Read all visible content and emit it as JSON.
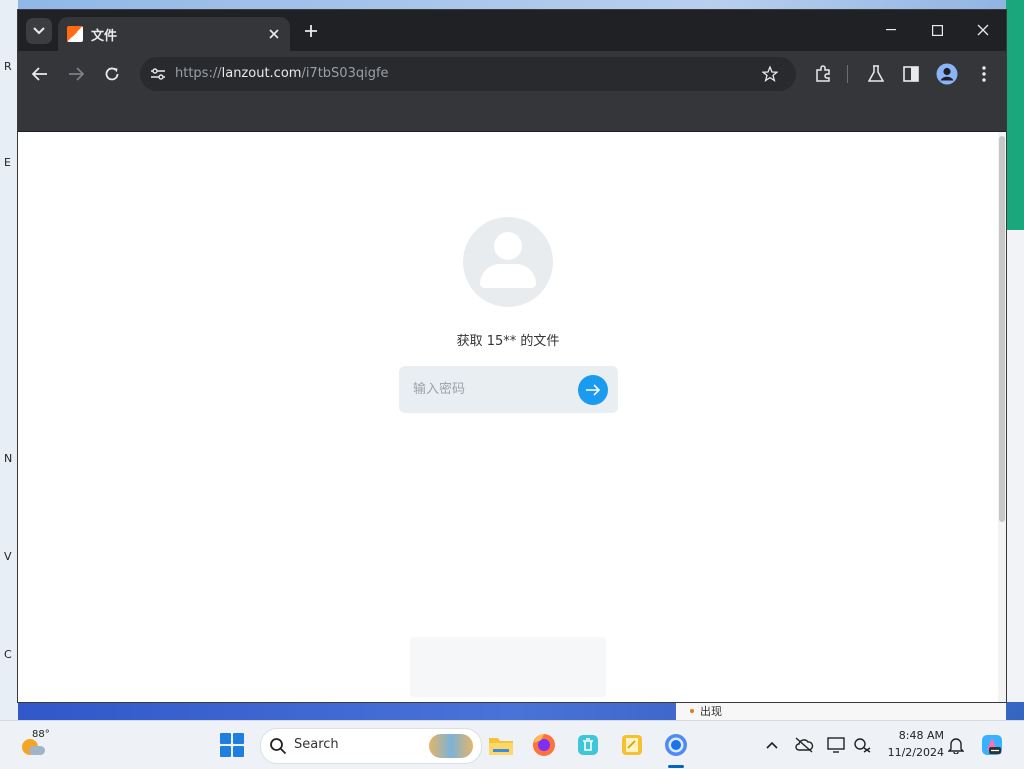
{
  "desktop": {
    "edge_letters": [
      "R",
      "E",
      "N",
      "V",
      "C"
    ],
    "widget_text": "出现"
  },
  "browser": {
    "tab": {
      "title": "文件"
    },
    "address": {
      "scheme": "https://",
      "host": "lanzout.com",
      "path": "/i7tbS03qigfe"
    }
  },
  "page": {
    "owner_text": "获取 15** 的文件",
    "password": {
      "placeholder": "输入密码",
      "value": ""
    }
  },
  "taskbar": {
    "weather_temp": "88°",
    "search_label": "Search",
    "apps": [
      "file-explorer",
      "firefox",
      "recycle-app",
      "notes-app",
      "chrome"
    ],
    "clock_time": "8:48 AM",
    "clock_date": "11/2/2024"
  },
  "colors": {
    "accent": "#1a9bf0",
    "browser_dark": "#202124",
    "favicon_orange": "#ff6a13"
  }
}
